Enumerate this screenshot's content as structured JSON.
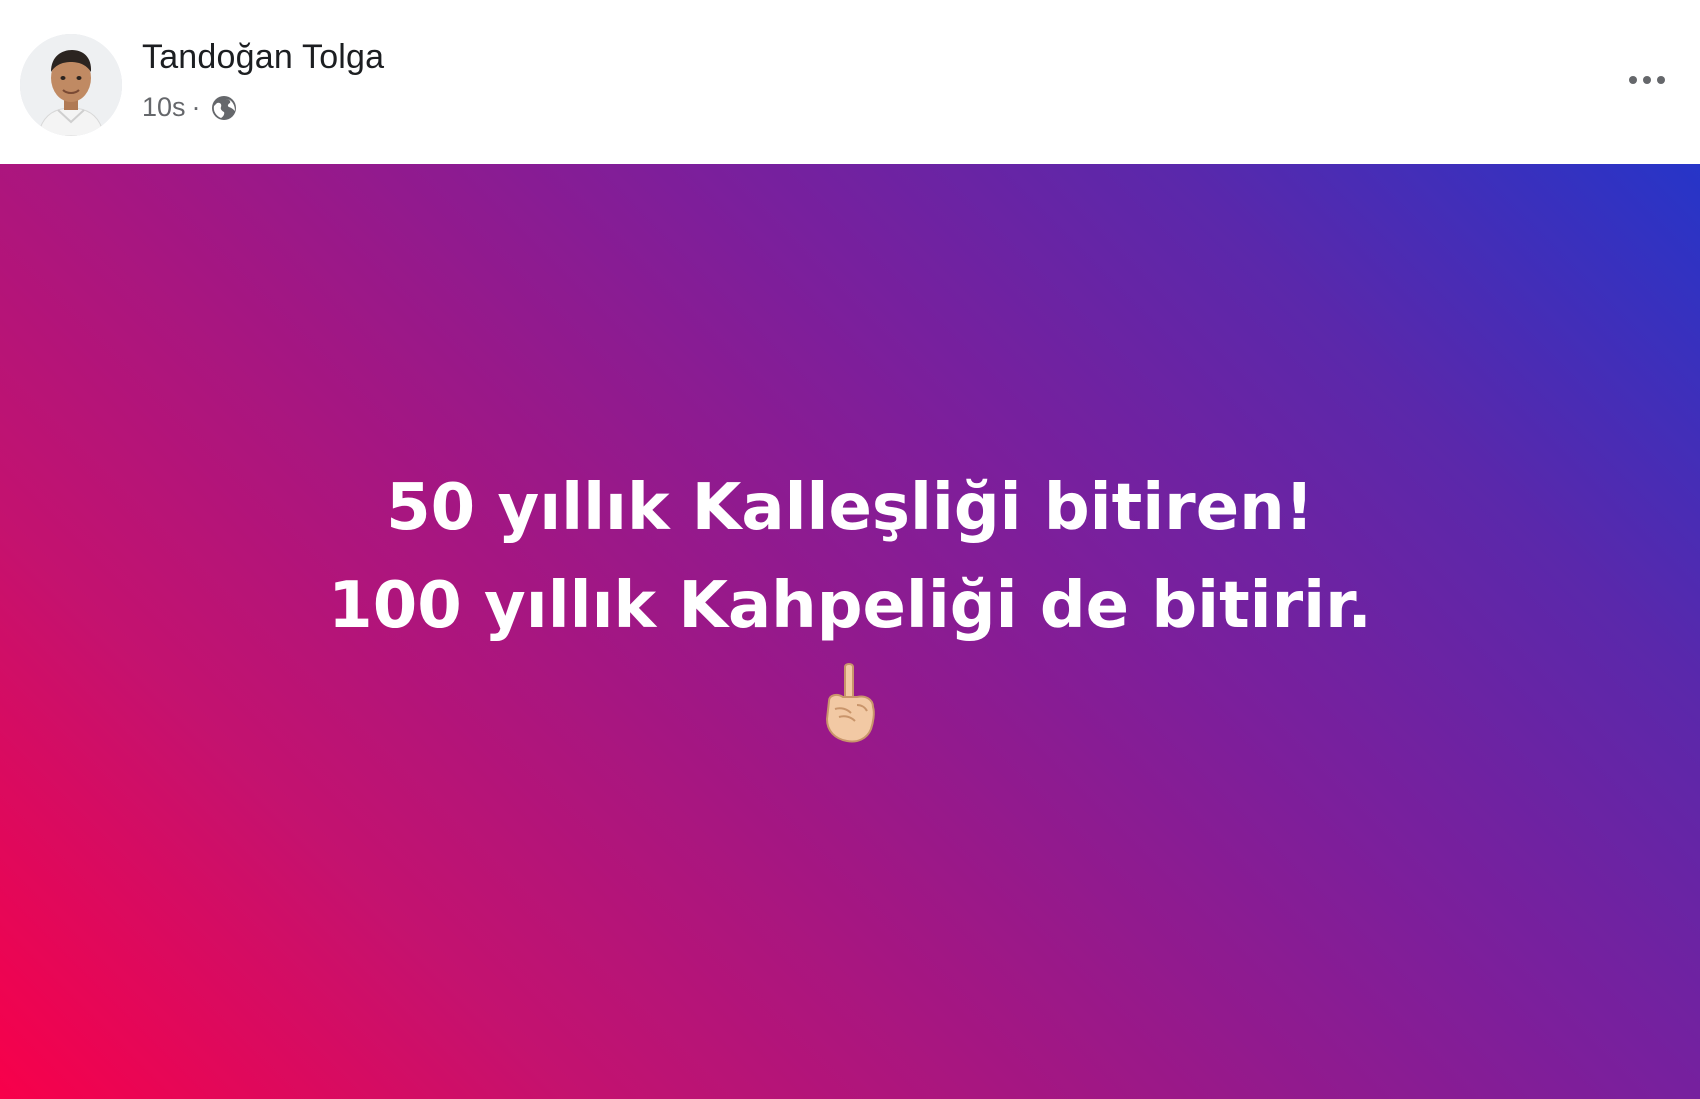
{
  "author": {
    "name": "Tandoğan Tolga",
    "timestamp": "10s",
    "separator": "·",
    "privacy_icon": "globe-icon"
  },
  "header": {
    "more_icon": "more-options-icon"
  },
  "post": {
    "lines": [
      "50 yıllık Kalleşliği bitiren!",
      "100 yıllık Kahpeliği de bitirir."
    ],
    "emoji_icon": "pointing-up-hand-icon",
    "text_color": "#ffffff",
    "background_colors": [
      "#f8004a",
      "#a01785",
      "#2635c8"
    ]
  }
}
